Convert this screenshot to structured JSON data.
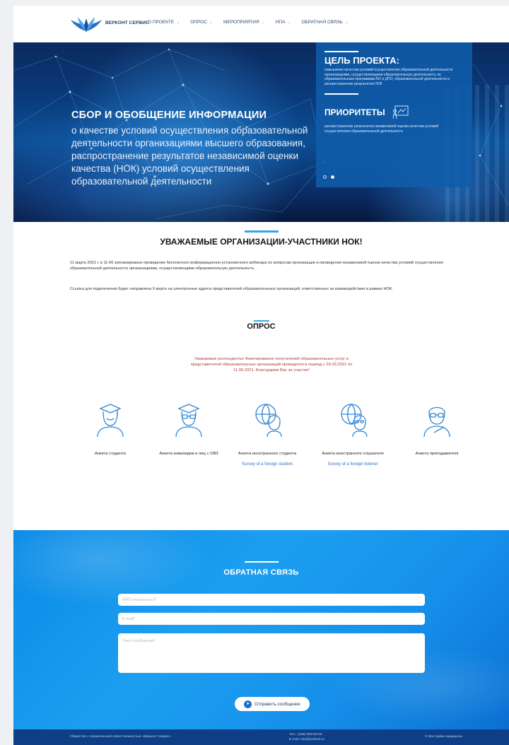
{
  "header": {
    "logo_text": "ВЕРКОНТ СЕРВИС",
    "nav": [
      {
        "label": "О ПРОЕКТЕ"
      },
      {
        "label": "ОПРОС"
      },
      {
        "label": "МЕРОПРИЯТИЯ"
      },
      {
        "label": "НПА"
      },
      {
        "label": "ОБРАТНАЯ СВЯЗЬ"
      }
    ]
  },
  "hero": {
    "title": "СБОР И ОБОБЩЕНИЕ ИНФОРМАЦИИ",
    "description": "о качестве условий осуществления образовательной деятельности организациями высшего образования, распространение результатов независимой оценки качества (НОК) условий осуществления образовательной деятельности",
    "goal_title": "ЦЕЛЬ ПРОЕКТА:",
    "goal_text": "повышение качества условий осуществления образовательной деятельности организациями, осуществляющими образовательную деятельность по образовательным программам ВО и ДПО, образовательной деятельности и распространение результатов НОК",
    "priorities_title": "ПРИОРИТЕТЫ",
    "priorities_text": "распространение результатов независимой оценки качества условий осуществления образовательной деятельности",
    "slides": [
      false,
      true
    ]
  },
  "notice": {
    "title": "УВАЖАЕМЫЕ ОРГАНИЗАЦИИ-УЧАСТНИКИ НОК!",
    "paragraph1": "11 марта 2021 г. в 11-00 запланировано проведение бесплатного информационно-установочного вебинара по вопросам организации и проведения независимой оценки качества условий осуществления образовательной деятельности организациями, осуществляющими образовательную деятельность.",
    "paragraph2": "Ссылка для подключения будет направлена 9 марта на электронные адреса представителей образовательных организаций, ответственных за взаимодействие в рамках НОК."
  },
  "survey": {
    "title": "ОПРОС",
    "note": "Уважаемые респонденты! Анкетирование получателей образовательных услуг и представителей образовательных организаций проводится в период с 29.03.2021 по 11.06.2021. Благодарим Вас за участие!",
    "cards": [
      {
        "icon": "student-graduate-icon",
        "label": "Анкета студента",
        "link": ""
      },
      {
        "icon": "student-disabled-icon",
        "label": "Анкета инвалидов и лиц с ОВЗ",
        "link": ""
      },
      {
        "icon": "foreign-student-icon",
        "label": "Анкета иностранного студента",
        "link": "Survey of a foreign student"
      },
      {
        "icon": "foreign-listener-icon",
        "label": "Анкета иностранного слушателя",
        "link": "Survey of a foreign listener"
      },
      {
        "icon": "teacher-icon",
        "label": "Анкета преподавателя",
        "link": ""
      }
    ]
  },
  "feedback": {
    "title": "ОБРАТНАЯ СВЯЗЬ",
    "name_placeholder": "ФИО (полностью)*",
    "email_placeholder": "E-mail*",
    "message_placeholder": "Текст сообщения*",
    "send_label": "Отправить сообщение"
  },
  "footer": {
    "org": "Общество с ограниченной ответственностью «Верконт Сервис»",
    "phone": "Тел.: (495) 000-00-00",
    "email": "E-mail: info@verkont.ru",
    "copyright": "© Все права защищены"
  },
  "colors": {
    "accent": "#35a7e8",
    "hero_panel": "#105caa",
    "feedback_bg": "#1690ea",
    "footer_bg": "#0d3e86",
    "notice_red": "#b23a3a",
    "link": "#2f72c8"
  }
}
